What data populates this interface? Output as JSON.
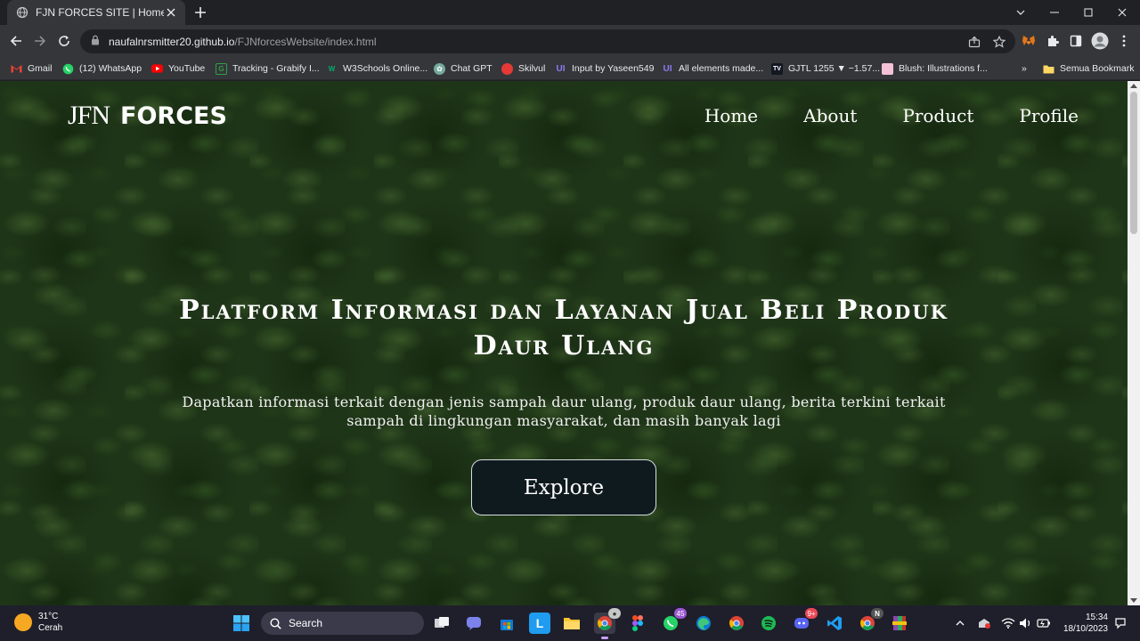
{
  "browser": {
    "tab": {
      "title": "FJN FORCES SITE | Home"
    },
    "address": {
      "host": "naufalnrsmitter20.github.io",
      "path": "/FJNforcesWebsite/index.html"
    }
  },
  "bookmarks": [
    {
      "label": "Gmail",
      "icon": "gmail-icon",
      "color": "#ea4335"
    },
    {
      "label": "(12) WhatsApp",
      "icon": "whatsapp-icon",
      "color": "#25d366"
    },
    {
      "label": "YouTube",
      "icon": "youtube-icon",
      "color": "#ff0000"
    },
    {
      "label": "Tracking - Grabify I...",
      "icon": "grabify-icon",
      "color": "#2ea043"
    },
    {
      "label": "W3Schools Online...",
      "icon": "w3schools-icon",
      "color": "#04aa6d"
    },
    {
      "label": "Chat GPT",
      "icon": "chatgpt-icon",
      "color": "#74aa9c"
    },
    {
      "label": "Skilvul",
      "icon": "skilvul-icon",
      "color": "#e53935"
    },
    {
      "label": "Input by Yaseen549",
      "icon": "ui-icon",
      "color": "#6c5ce7"
    },
    {
      "label": "All elements made...",
      "icon": "ui-icon",
      "color": "#6c5ce7"
    },
    {
      "label": "GJTL 1255 ▼ −1.57...",
      "icon": "tradingview-icon",
      "color": "#131722"
    },
    {
      "label": "Blush: Illustrations f...",
      "icon": "blush-icon",
      "color": "#f48fb1"
    }
  ],
  "bookmarks_overflow": "»",
  "bookmarks_folder": "Semua Bookmark",
  "page": {
    "logo_mark": "JFN",
    "logo_word": "FORCES",
    "nav": [
      "Home",
      "About",
      "Product",
      "Profile"
    ],
    "hero_title_line1": "Platform Informasi dan Layanan Jual Beli Produk",
    "hero_title_line2": "Daur Ulang",
    "hero_subtitle": "Dapatkan informasi terkait dengan jenis sampah daur ulang, produk daur ulang, berita terkini terkait sampah di lingkungan masyarakat, dan masih banyak lagi",
    "cta": "Explore"
  },
  "taskbar": {
    "weather_temp": "31°C",
    "weather_desc": "Cerah",
    "search_label": "Search",
    "whatsapp_badge": "45",
    "discord_badge": "9+",
    "time": "15:34",
    "date": "18/10/2023"
  }
}
